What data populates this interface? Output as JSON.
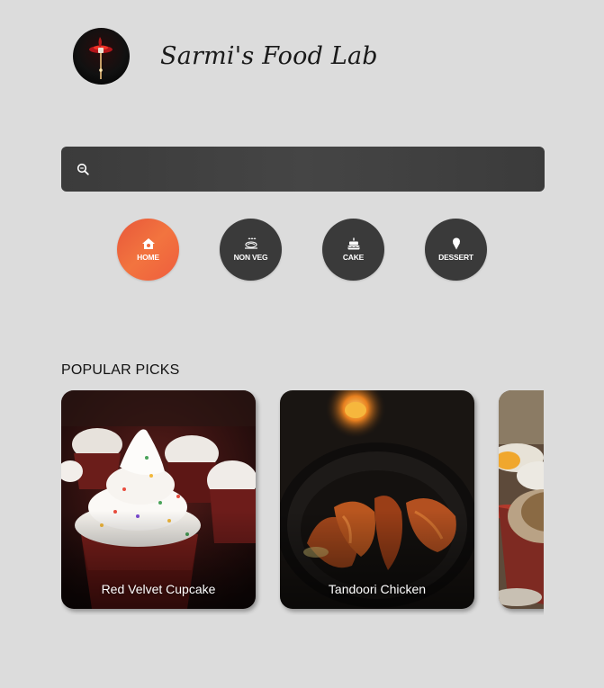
{
  "header": {
    "brand": "Sarmi's Food Lab",
    "logo_icon": "flame-fork-logo"
  },
  "search": {
    "icon": "search-icon",
    "placeholder": "",
    "value": ""
  },
  "categories": [
    {
      "label": "HOME",
      "icon": "home-icon",
      "active": true
    },
    {
      "label": "NON VEG",
      "icon": "chicken-icon",
      "active": false
    },
    {
      "label": "CAKE",
      "icon": "cake-icon",
      "active": false
    },
    {
      "label": "DESSERT",
      "icon": "ice-cream-icon",
      "active": false
    }
  ],
  "popular": {
    "title": "POPULAR PICKS",
    "items": [
      {
        "title": "Red Velvet Cupcake"
      },
      {
        "title": "Tandoori Chicken"
      },
      {
        "title": ""
      }
    ]
  },
  "colors": {
    "background": "#dcdcdc",
    "accent_start": "#e8573a",
    "accent_end": "#f2743f",
    "dark": "#3a3a3a"
  }
}
